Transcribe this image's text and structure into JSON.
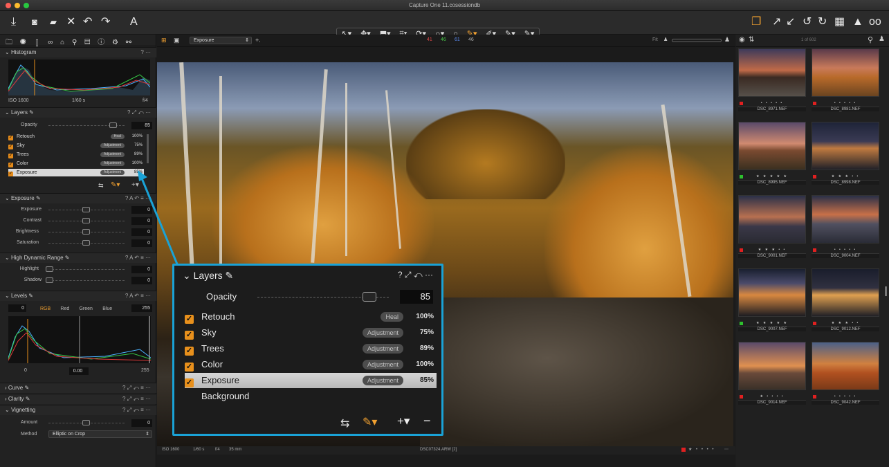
{
  "app": {
    "title": "Capture One 11.cosessiondb"
  },
  "toolbar": {
    "left_icons": [
      "import-icon",
      "camera-icon",
      "folder-icon",
      "close-icon",
      "undo-icon",
      "redo-icon",
      "text-icon"
    ],
    "right_icons": [
      "stack-icon",
      "expand-icon",
      "collapse-icon",
      "rotate-left-icon",
      "rotate-right-icon",
      "grid-icon",
      "warning-icon",
      "glasses-icon"
    ],
    "cursor_tools": [
      "↖▾",
      "✥▾",
      "⬒▾",
      "⌗▾",
      "⟳▾",
      "∩▾",
      "○",
      "✎▾",
      "✐▾",
      "✎▾",
      "✎▾"
    ]
  },
  "left_tabs": "🗀 ◉ ▯ ∞ ⌂ ⚲ ▤ ⓘ ⚙ ⚯",
  "histogram": {
    "title": "Histogram",
    "iso": "ISO 1600",
    "shutter": "1/60 s",
    "aperture": "f/4"
  },
  "layers_small": {
    "title": "Layers",
    "opacity_label": "Opacity",
    "opacity_value": "85",
    "layers": [
      {
        "name": "Retouch",
        "tag": "Heal",
        "pct": "100%"
      },
      {
        "name": "Sky",
        "tag": "Adjustment",
        "pct": "75%"
      },
      {
        "name": "Trees",
        "tag": "Adjustment",
        "pct": "89%"
      },
      {
        "name": "Color",
        "tag": "Adjustment",
        "pct": "100%"
      },
      {
        "name": "Exposure",
        "tag": "Adjustment",
        "pct": "85%"
      }
    ]
  },
  "exposure_panel": {
    "title": "Exposure",
    "rows": [
      {
        "label": "Exposure",
        "value": "0"
      },
      {
        "label": "Contrast",
        "value": "0"
      },
      {
        "label": "Brightness",
        "value": "0"
      },
      {
        "label": "Saturation",
        "value": "0"
      }
    ]
  },
  "hdr_panel": {
    "title": "High Dynamic Range",
    "rows": [
      {
        "label": "Highlight",
        "value": "0"
      },
      {
        "label": "Shadow",
        "value": "0"
      }
    ]
  },
  "levels_panel": {
    "title": "Levels",
    "low": "0",
    "high": "255",
    "channels": [
      "RGB",
      "Red",
      "Green",
      "Blue"
    ],
    "out_low": "0",
    "mid": "0.00",
    "out_high": "255"
  },
  "collapsed_panels": [
    "Curve",
    "Clarity",
    "Vignetting"
  ],
  "vignetting": {
    "amount_label": "Amount",
    "amount_value": "0",
    "method_label": "Method",
    "method_value": "Elliptic on Crop"
  },
  "viewer": {
    "preset": "Exposure",
    "rgb": {
      "r": "41",
      "g": "46",
      "b": "61",
      "l": "46"
    },
    "fit": "Fit",
    "status": {
      "iso": "ISO 1600",
      "shutter": "1/60 s",
      "aperture": "f/4",
      "focal": "35 mm",
      "filename": "DSC07324.ARW [2]"
    }
  },
  "popup": {
    "title": "Layers",
    "opacity_label": "Opacity",
    "opacity_value": "85",
    "opacity_fraction": 0.85,
    "layers": [
      {
        "name": "Retouch",
        "tag": "Heal",
        "pct": "100%",
        "checked": true
      },
      {
        "name": "Sky",
        "tag": "Adjustment",
        "pct": "75%",
        "checked": true
      },
      {
        "name": "Trees",
        "tag": "Adjustment",
        "pct": "89%",
        "checked": true
      },
      {
        "name": "Color",
        "tag": "Adjustment",
        "pct": "100%",
        "checked": true
      },
      {
        "name": "Exposure",
        "tag": "Adjustment",
        "pct": "85%",
        "checked": true,
        "selected": true
      },
      {
        "name": "Background",
        "tag": "",
        "pct": "",
        "checked": false
      }
    ]
  },
  "browser": {
    "counter": "1 of 602",
    "thumbs": [
      {
        "file": "DSC_8971.NEF",
        "stars": "• • • • •",
        "color": "#e02020"
      },
      {
        "file": "DSC_8981.NEF",
        "stars": "• • • • •",
        "color": "#e02020"
      },
      {
        "file": "DSC_8995.NEF",
        "stars": "★ ★ ★ ★ ★",
        "color": "#2ec02e"
      },
      {
        "file": "DSC_8998.NEF",
        "stars": "★ ★ ★ • •",
        "color": "#e02020"
      },
      {
        "file": "DSC_9001.NEF",
        "stars": "★ ★ ★ • •",
        "color": "#e02020"
      },
      {
        "file": "DSC_9004.NEF",
        "stars": "• • • • •",
        "color": "#e02020"
      },
      {
        "file": "DSC_9007.NEF",
        "stars": "★ ★ ★ ★ ★",
        "color": "#2ec02e"
      },
      {
        "file": "DSC_9012.NEF",
        "stars": "★ ★ ★ • •",
        "color": "#e02020"
      },
      {
        "file": "DSC_9014.NEF",
        "stars": "★ • • • •",
        "color": "#e02020"
      },
      {
        "file": "DSC_9042.NEF",
        "stars": "• • • • •",
        "color": "#e02020"
      }
    ]
  }
}
